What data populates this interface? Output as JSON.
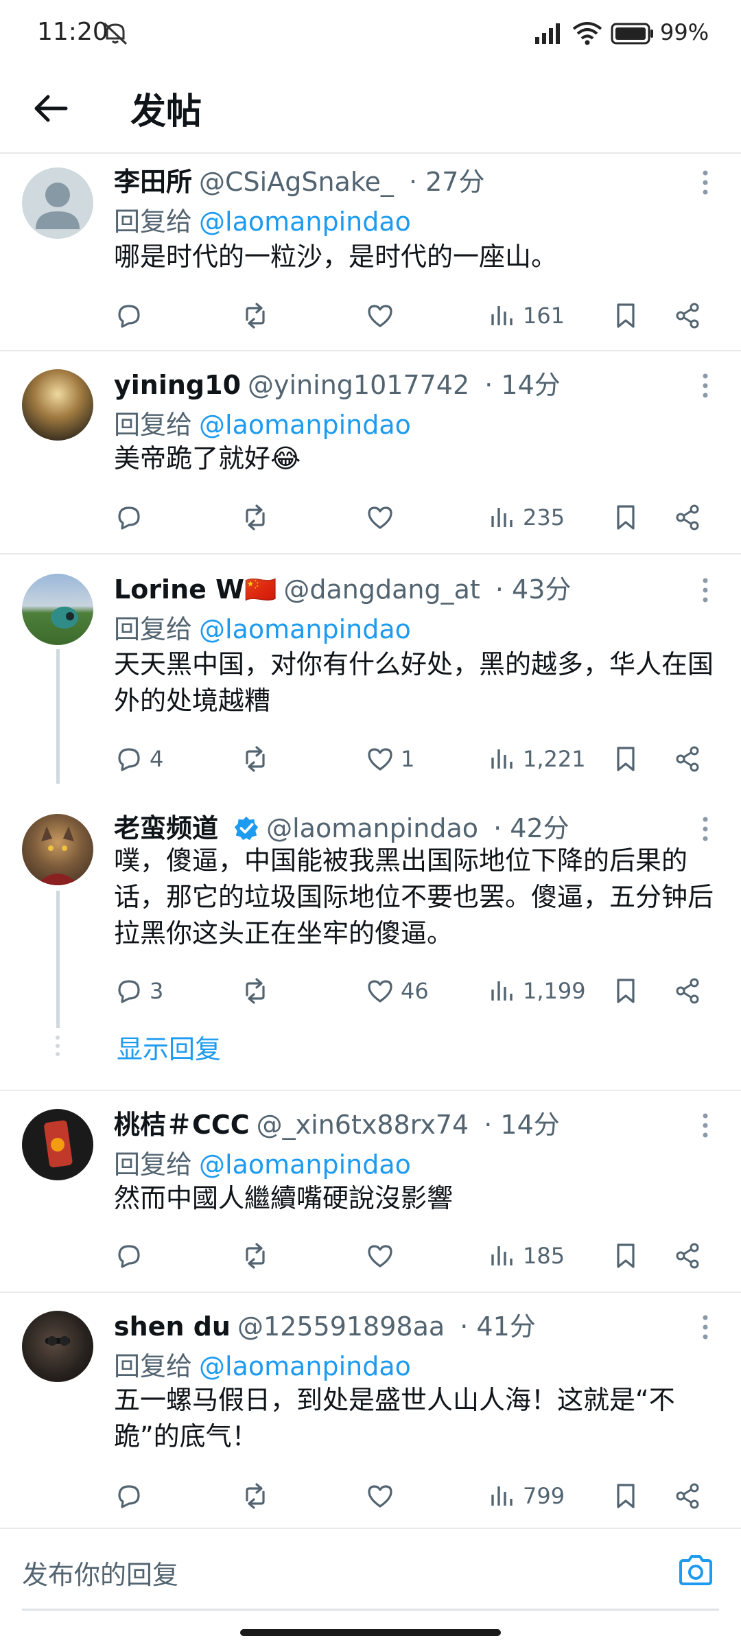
{
  "status": {
    "time": "11:20",
    "battery": "99%"
  },
  "header": {
    "title": "发帖"
  },
  "posts": [
    {
      "name": "李田所",
      "handle": "@CSiAgSnake_",
      "time": "· 27分",
      "reply_label": "回复给",
      "reply_to": "@laomanpindao",
      "text": "哪是时代的一粒沙，是时代的一座山。",
      "replies": "",
      "retweets": "",
      "likes": "",
      "views": "161"
    },
    {
      "name": "yining10",
      "handle": "@yining1017742",
      "time": "· 14分",
      "reply_label": "回复给",
      "reply_to": "@laomanpindao",
      "text": "美帝跪了就好😂",
      "replies": "",
      "retweets": "",
      "likes": "",
      "views": "235"
    },
    {
      "name": "Lorine W🇨🇳",
      "handle": "@dangdang_at",
      "time": "· 43分",
      "reply_label": "回复给",
      "reply_to": "@laomanpindao",
      "text": "天天黑中国，对你有什么好处，黑的越多，华人在国外的处境越糟",
      "replies": "4",
      "retweets": "",
      "likes": "1",
      "views": "1,221"
    },
    {
      "name": "老蛮频道",
      "handle": "@laomanpindao",
      "time": "· 42分",
      "text": "噗，傻逼，中国能被我黑出国际地位下降的后果的话，那它的垃圾国际地位不要也罢。傻逼，五分钟后拉黑你这头正在坐牢的傻逼。",
      "replies": "3",
      "retweets": "",
      "likes": "46",
      "views": "1,199",
      "show_replies": "显示回复"
    },
    {
      "name": "桃桔＃CCC",
      "handle": "@_xin6tx88rx74",
      "time": "· 14分",
      "reply_label": "回复给",
      "reply_to": "@laomanpindao",
      "text": "然而中國人繼續嘴硬說沒影響",
      "replies": "",
      "retweets": "",
      "likes": "",
      "views": "185"
    },
    {
      "name": "shen du",
      "handle": "@125591898aa",
      "time": "· 41分",
      "reply_label": "回复给",
      "reply_to": "@laomanpindao",
      "text": "五一螺马假日，到处是盛世人山人海！这就是“不跪”的底气！",
      "replies": "",
      "retweets": "",
      "likes": "",
      "views": "799"
    }
  ],
  "composer": {
    "placeholder": "发布你的回复"
  },
  "colors": {
    "accent": "#1d9bf0",
    "text": "#0f1419",
    "muted": "#536471",
    "divider": "#e7e9ea"
  }
}
